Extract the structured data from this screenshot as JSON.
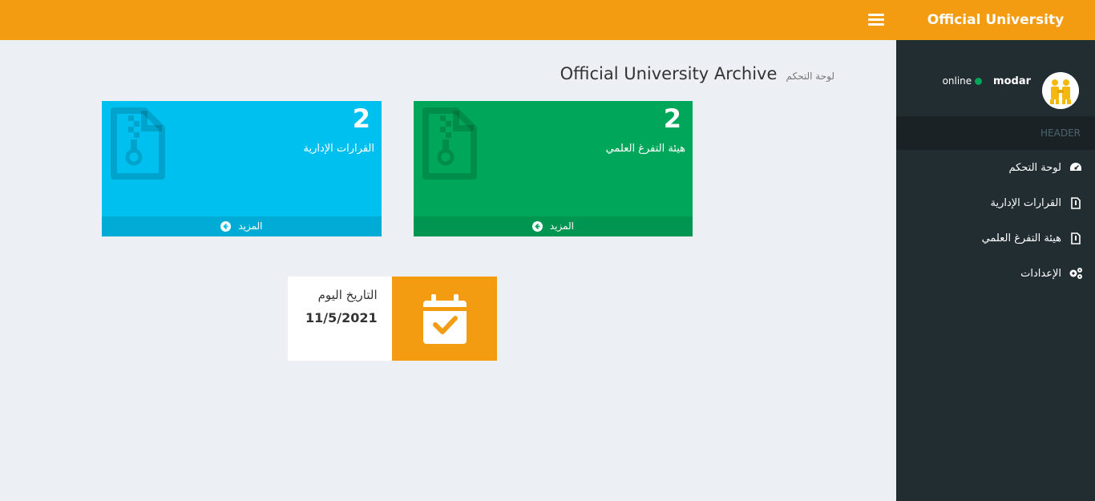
{
  "header": {
    "brand": "Official University Archive"
  },
  "sidebar": {
    "user": {
      "name": "modar",
      "status": "online"
    },
    "menu_header": "HEADER",
    "items": [
      {
        "label": "لوحة التحكم",
        "icon": "dashboard-icon"
      },
      {
        "label": "القرارات الإدارية",
        "icon": "file-icon"
      },
      {
        "label": "هيئة التفرغ العلمي",
        "icon": "file-icon"
      },
      {
        "label": "الإعدادات",
        "icon": "gears-icon"
      }
    ]
  },
  "content": {
    "title": "Official University Archive",
    "subtitle": "لوحة التحكم",
    "boxes": [
      {
        "count": "2",
        "label": "القرارات الإدارية",
        "more": "المزيد",
        "color": "#00c0ef"
      },
      {
        "count": "2",
        "label": "هيئة التفرغ العلمي",
        "more": "المزيد",
        "color": "#00a65a"
      }
    ],
    "date_box": {
      "label": "التاريخ اليوم",
      "value": "11/5/2021",
      "color": "#f39c12"
    }
  },
  "colors": {
    "accent": "#f39c12",
    "sidebar": "#222d32",
    "aqua": "#00c0ef",
    "green": "#00a65a"
  }
}
